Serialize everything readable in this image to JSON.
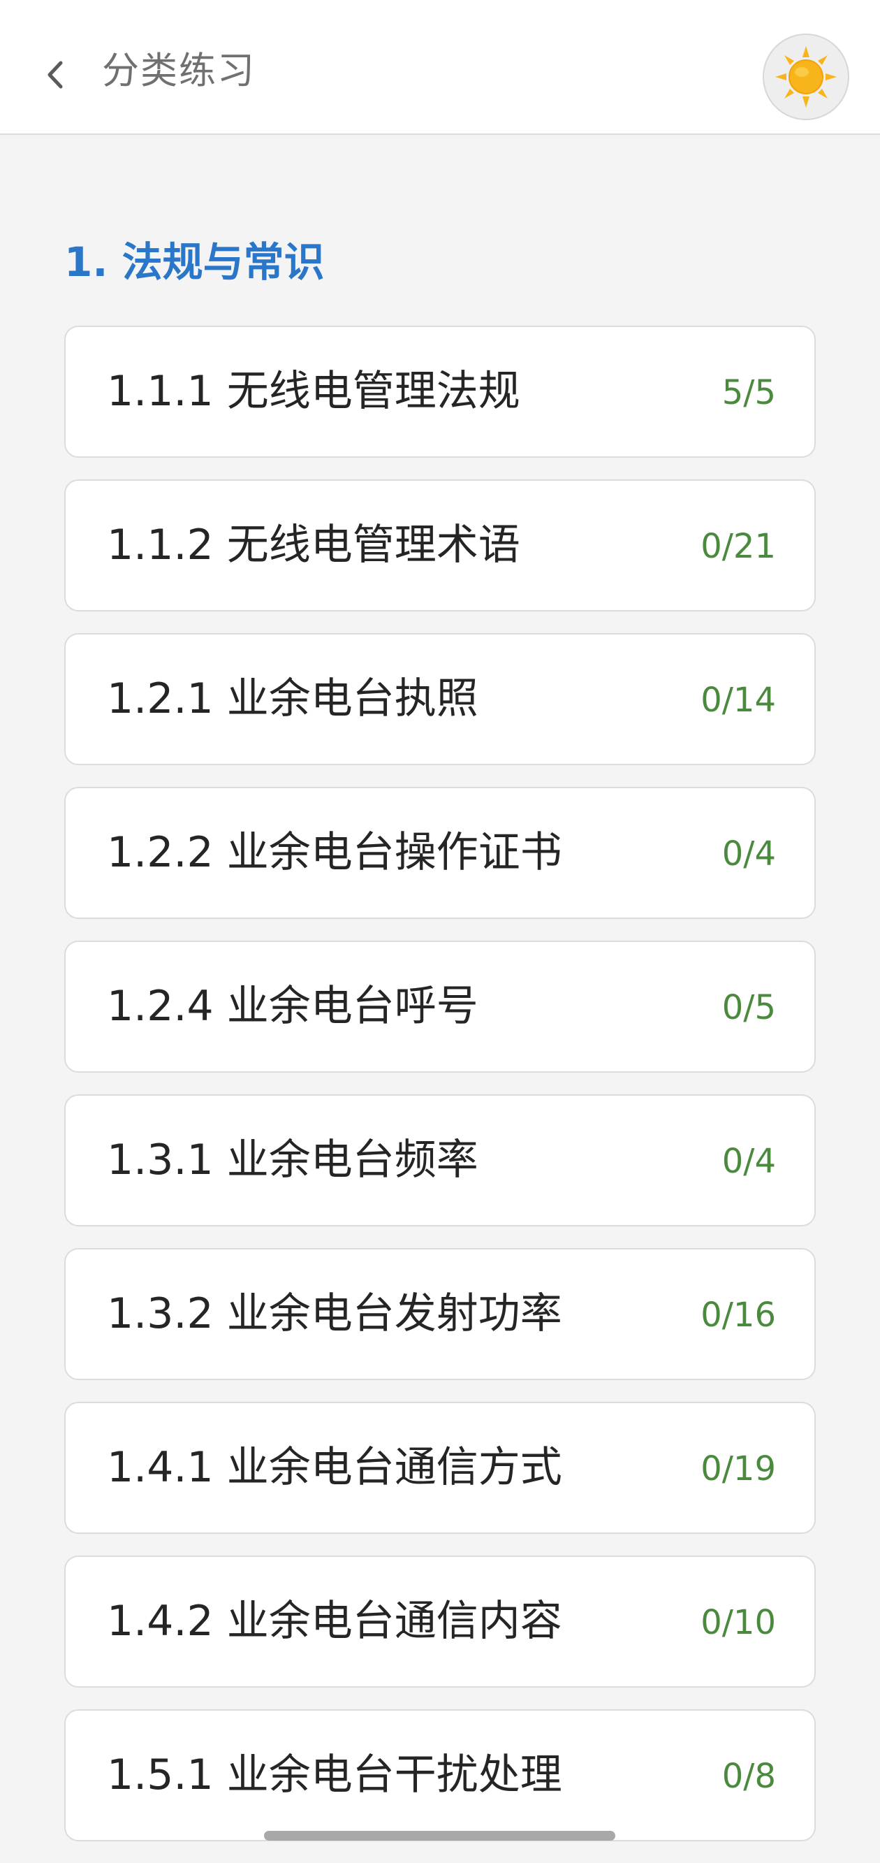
{
  "header": {
    "title": "分类练习",
    "back_icon": "chevron-left-icon",
    "theme_icon": "sun-icon"
  },
  "section": {
    "title": "1. 法规与常识"
  },
  "items": [
    {
      "label": "1.1.1 无线电管理法规",
      "count": "5/5"
    },
    {
      "label": "1.1.2 无线电管理术语",
      "count": "0/21"
    },
    {
      "label": "1.2.1 业余电台执照",
      "count": "0/14"
    },
    {
      "label": "1.2.2 业余电台操作证书",
      "count": "0/4"
    },
    {
      "label": "1.2.4 业余电台呼号",
      "count": "0/5"
    },
    {
      "label": "1.3.1 业余电台频率",
      "count": "0/4"
    },
    {
      "label": "1.3.2 业余电台发射功率",
      "count": "0/16"
    },
    {
      "label": "1.4.1 业余电台通信方式",
      "count": "0/19"
    },
    {
      "label": "1.4.2 业余电台通信内容",
      "count": "0/10"
    },
    {
      "label": "1.5.1 业余电台干扰处理",
      "count": "0/8"
    }
  ],
  "colors": {
    "accent": "#2a76c9",
    "count": "#4a8a3c",
    "sun": "#f7b51b"
  }
}
